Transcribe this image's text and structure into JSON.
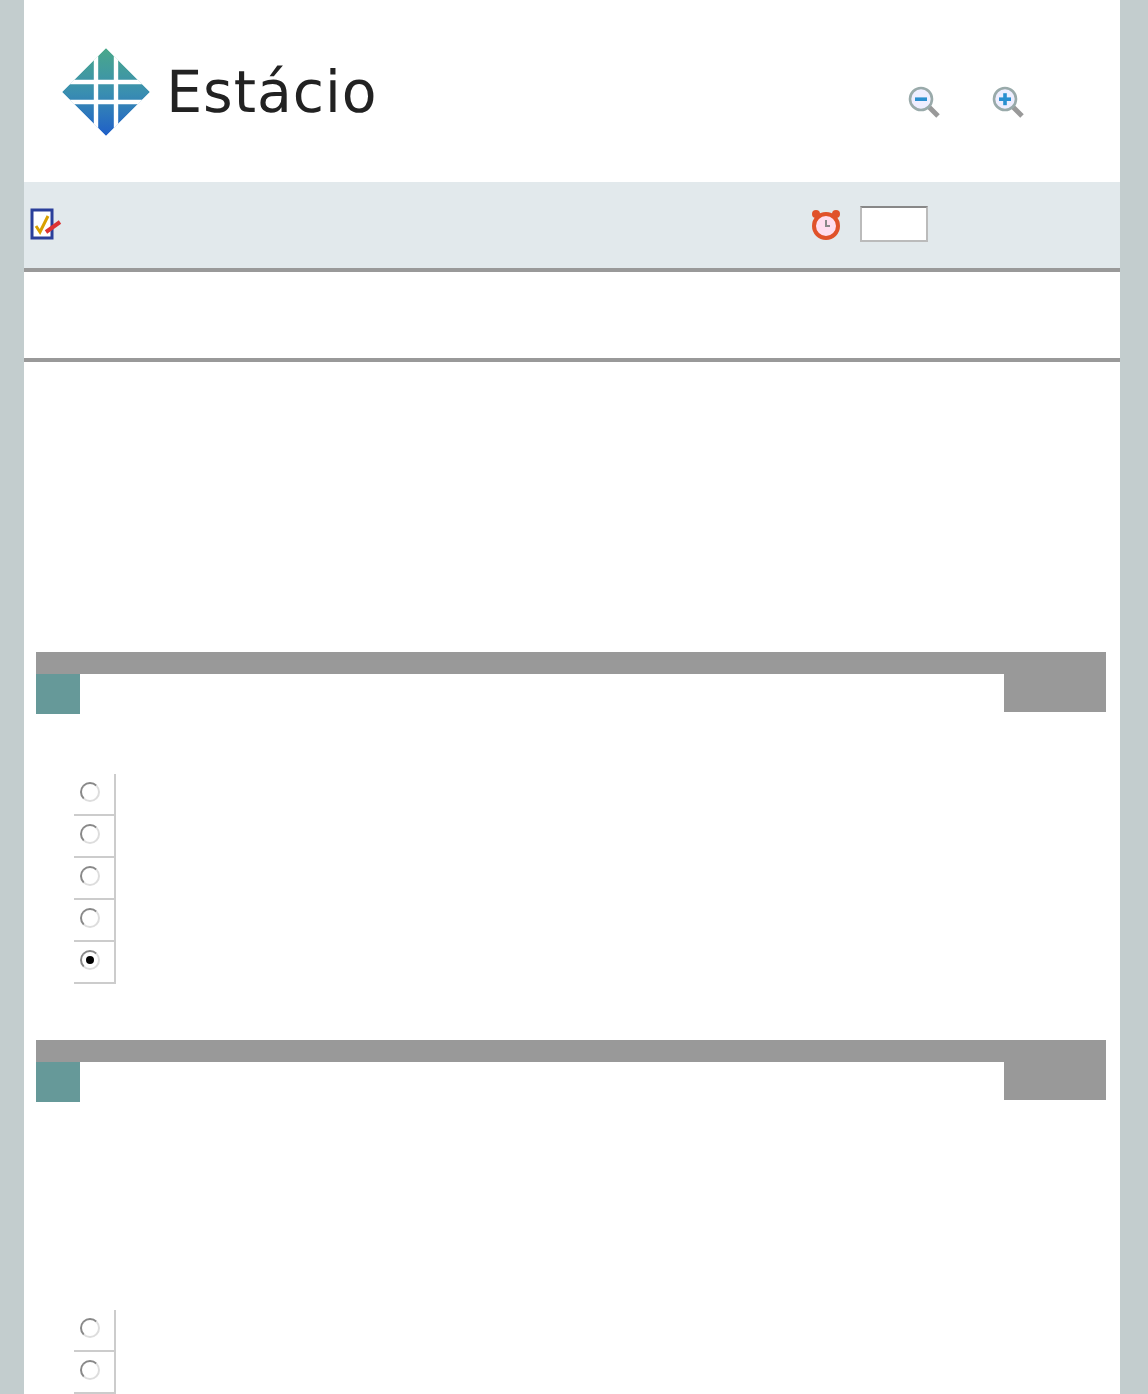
{
  "header": {
    "logo_text": "Estácio"
  },
  "questions": [
    {
      "options": [
        {
          "selected": false
        },
        {
          "selected": false
        },
        {
          "selected": false
        },
        {
          "selected": false
        },
        {
          "selected": true
        }
      ]
    },
    {
      "options": [
        {
          "selected": false
        },
        {
          "selected": false
        }
      ]
    }
  ]
}
